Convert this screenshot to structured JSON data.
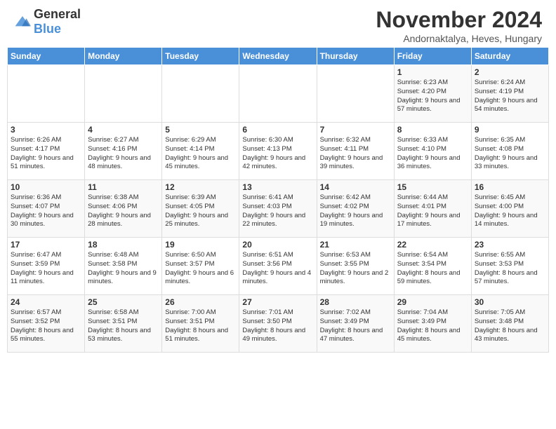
{
  "header": {
    "logo": {
      "general": "General",
      "blue": "Blue"
    },
    "title": "November 2024",
    "subtitle": "Andornaktalya, Heves, Hungary"
  },
  "weekdays": [
    "Sunday",
    "Monday",
    "Tuesday",
    "Wednesday",
    "Thursday",
    "Friday",
    "Saturday"
  ],
  "weeks": [
    [
      {
        "day": "",
        "detail": ""
      },
      {
        "day": "",
        "detail": ""
      },
      {
        "day": "",
        "detail": ""
      },
      {
        "day": "",
        "detail": ""
      },
      {
        "day": "",
        "detail": ""
      },
      {
        "day": "1",
        "detail": "Sunrise: 6:23 AM\nSunset: 4:20 PM\nDaylight: 9 hours and 57 minutes."
      },
      {
        "day": "2",
        "detail": "Sunrise: 6:24 AM\nSunset: 4:19 PM\nDaylight: 9 hours and 54 minutes."
      }
    ],
    [
      {
        "day": "3",
        "detail": "Sunrise: 6:26 AM\nSunset: 4:17 PM\nDaylight: 9 hours and 51 minutes."
      },
      {
        "day": "4",
        "detail": "Sunrise: 6:27 AM\nSunset: 4:16 PM\nDaylight: 9 hours and 48 minutes."
      },
      {
        "day": "5",
        "detail": "Sunrise: 6:29 AM\nSunset: 4:14 PM\nDaylight: 9 hours and 45 minutes."
      },
      {
        "day": "6",
        "detail": "Sunrise: 6:30 AM\nSunset: 4:13 PM\nDaylight: 9 hours and 42 minutes."
      },
      {
        "day": "7",
        "detail": "Sunrise: 6:32 AM\nSunset: 4:11 PM\nDaylight: 9 hours and 39 minutes."
      },
      {
        "day": "8",
        "detail": "Sunrise: 6:33 AM\nSunset: 4:10 PM\nDaylight: 9 hours and 36 minutes."
      },
      {
        "day": "9",
        "detail": "Sunrise: 6:35 AM\nSunset: 4:08 PM\nDaylight: 9 hours and 33 minutes."
      }
    ],
    [
      {
        "day": "10",
        "detail": "Sunrise: 6:36 AM\nSunset: 4:07 PM\nDaylight: 9 hours and 30 minutes."
      },
      {
        "day": "11",
        "detail": "Sunrise: 6:38 AM\nSunset: 4:06 PM\nDaylight: 9 hours and 28 minutes."
      },
      {
        "day": "12",
        "detail": "Sunrise: 6:39 AM\nSunset: 4:05 PM\nDaylight: 9 hours and 25 minutes."
      },
      {
        "day": "13",
        "detail": "Sunrise: 6:41 AM\nSunset: 4:03 PM\nDaylight: 9 hours and 22 minutes."
      },
      {
        "day": "14",
        "detail": "Sunrise: 6:42 AM\nSunset: 4:02 PM\nDaylight: 9 hours and 19 minutes."
      },
      {
        "day": "15",
        "detail": "Sunrise: 6:44 AM\nSunset: 4:01 PM\nDaylight: 9 hours and 17 minutes."
      },
      {
        "day": "16",
        "detail": "Sunrise: 6:45 AM\nSunset: 4:00 PM\nDaylight: 9 hours and 14 minutes."
      }
    ],
    [
      {
        "day": "17",
        "detail": "Sunrise: 6:47 AM\nSunset: 3:59 PM\nDaylight: 9 hours and 11 minutes."
      },
      {
        "day": "18",
        "detail": "Sunrise: 6:48 AM\nSunset: 3:58 PM\nDaylight: 9 hours and 9 minutes."
      },
      {
        "day": "19",
        "detail": "Sunrise: 6:50 AM\nSunset: 3:57 PM\nDaylight: 9 hours and 6 minutes."
      },
      {
        "day": "20",
        "detail": "Sunrise: 6:51 AM\nSunset: 3:56 PM\nDaylight: 9 hours and 4 minutes."
      },
      {
        "day": "21",
        "detail": "Sunrise: 6:53 AM\nSunset: 3:55 PM\nDaylight: 9 hours and 2 minutes."
      },
      {
        "day": "22",
        "detail": "Sunrise: 6:54 AM\nSunset: 3:54 PM\nDaylight: 8 hours and 59 minutes."
      },
      {
        "day": "23",
        "detail": "Sunrise: 6:55 AM\nSunset: 3:53 PM\nDaylight: 8 hours and 57 minutes."
      }
    ],
    [
      {
        "day": "24",
        "detail": "Sunrise: 6:57 AM\nSunset: 3:52 PM\nDaylight: 8 hours and 55 minutes."
      },
      {
        "day": "25",
        "detail": "Sunrise: 6:58 AM\nSunset: 3:51 PM\nDaylight: 8 hours and 53 minutes."
      },
      {
        "day": "26",
        "detail": "Sunrise: 7:00 AM\nSunset: 3:51 PM\nDaylight: 8 hours and 51 minutes."
      },
      {
        "day": "27",
        "detail": "Sunrise: 7:01 AM\nSunset: 3:50 PM\nDaylight: 8 hours and 49 minutes."
      },
      {
        "day": "28",
        "detail": "Sunrise: 7:02 AM\nSunset: 3:49 PM\nDaylight: 8 hours and 47 minutes."
      },
      {
        "day": "29",
        "detail": "Sunrise: 7:04 AM\nSunset: 3:49 PM\nDaylight: 8 hours and 45 minutes."
      },
      {
        "day": "30",
        "detail": "Sunrise: 7:05 AM\nSunset: 3:48 PM\nDaylight: 8 hours and 43 minutes."
      }
    ]
  ]
}
